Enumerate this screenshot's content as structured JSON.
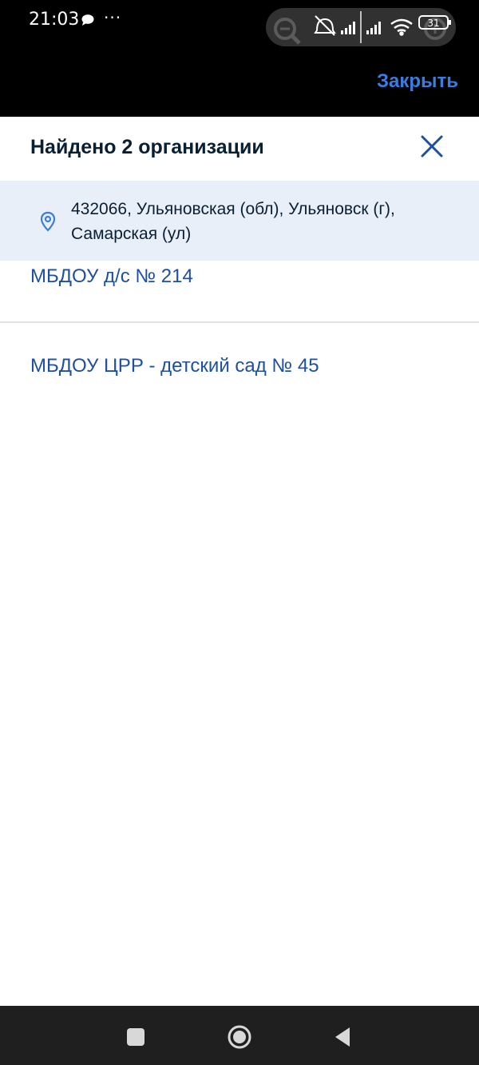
{
  "status_bar": {
    "time": "21:03",
    "dots": "···",
    "battery_level": "31",
    "icons": [
      "chat-icon",
      "zoom-out-icon",
      "mute-icon",
      "signal-icon",
      "signal-icon",
      "wifi-icon",
      "battery-icon",
      "zoom-in-icon"
    ]
  },
  "top": {
    "close_label": "Закрыть"
  },
  "header": {
    "title": "Найдено 2 организации"
  },
  "address": {
    "text": "432066, Ульяновская (обл), Ульяновск (г), Самарская (ул)"
  },
  "organizations": [
    {
      "name": "МБДОУ д/с № 214"
    },
    {
      "name": "МБДОУ ЦРР - детский сад № 45"
    }
  ],
  "colors": {
    "accent": "#1d4fa3",
    "link_top": "#3a7ce0",
    "title": "#0b1f33",
    "banner": "#e9eff9"
  }
}
